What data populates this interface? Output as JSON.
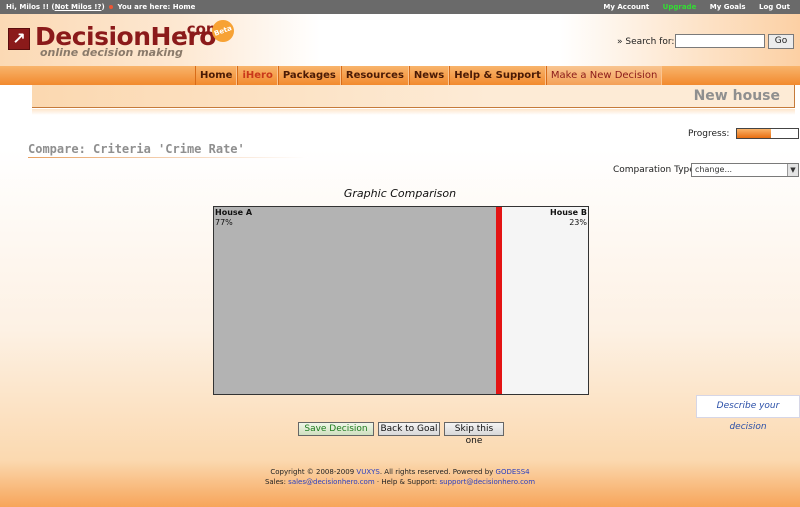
{
  "topbar": {
    "greeting": "Hi, Milos !! (",
    "not_user": "Not Milos !?",
    "greeting_end": ")",
    "location": "You are here: Home",
    "links": [
      "My Account",
      "Upgrade",
      "My Goals",
      "Log Out"
    ]
  },
  "header": {
    "logo_text": "DecisionHero",
    "logo_com": ".com",
    "logo_beta": "Beta",
    "tagline": "online decision making",
    "search_label": "» Search for:",
    "search_value": "",
    "go_label": "Go"
  },
  "nav": {
    "items": [
      "Home",
      "iHero",
      "Packages",
      "Resources",
      "News",
      "Help & Support",
      "Make a New Decision"
    ]
  },
  "page": {
    "heading": "New house",
    "progress_label": "Progress:",
    "progress_value": 0.55,
    "compare_title": "Compare: Criteria 'Crime Rate'",
    "comparison_type_label": "Comparation Type",
    "comparison_type_value": "change...",
    "graphic_title": "Graphic Comparison"
  },
  "chart_data": {
    "type": "bar",
    "title": "Graphic Comparison",
    "categories": [
      "House A",
      "House B"
    ],
    "values": [
      77,
      23
    ],
    "labels": [
      "77%",
      "23%"
    ],
    "colors": {
      "House A": "#b3b3b3",
      "House B": "#f5f5f5",
      "divider": "#e31414"
    }
  },
  "describe_label": "Describe your decision",
  "buttons": {
    "save": "Save Decision",
    "back": "Back to Goal",
    "skip": "Skip this one"
  },
  "footer": {
    "copyright": "Copyright © 2008-2009",
    "vuxys": "VUXYS",
    "rights": ". All rights reserved. Powered by",
    "godess": "GODESS4",
    "sales_label": "Sales:",
    "sales_email": "sales@decisionhero.com",
    "support_label": "· Help & Support:",
    "support_email": "support@decisionhero.com"
  }
}
